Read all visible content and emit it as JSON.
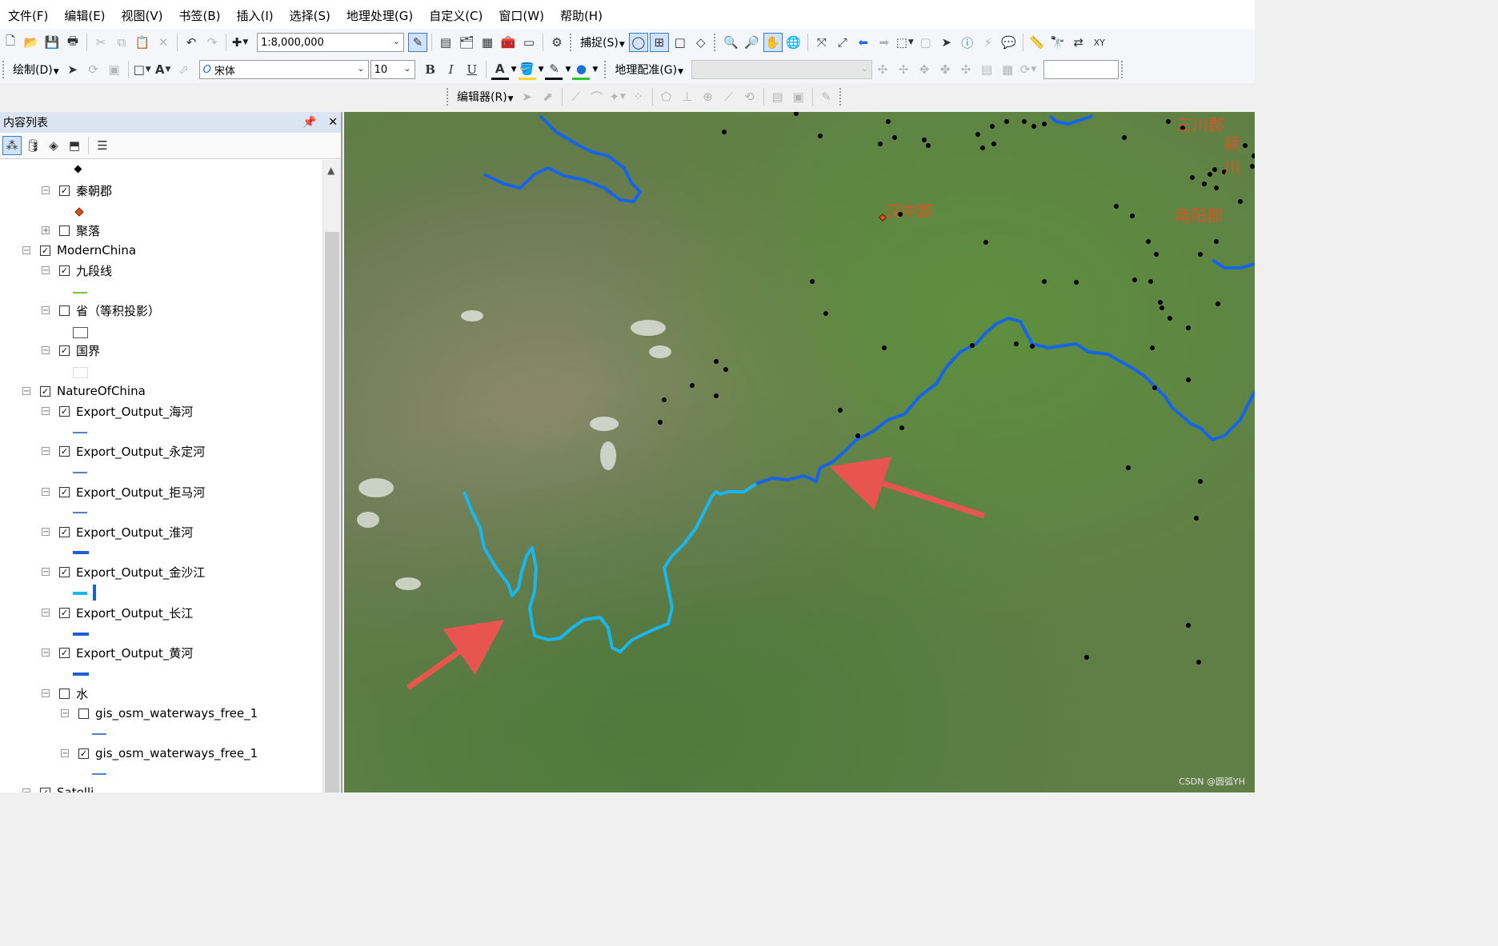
{
  "menu": [
    "文件(F)",
    "编辑(E)",
    "视图(V)",
    "书签(B)",
    "插入(I)",
    "选择(S)",
    "地理处理(G)",
    "自定义(C)",
    "窗口(W)",
    "帮助(H)"
  ],
  "toolbar1": {
    "scale_value": "1:8,000,000",
    "snapping_label": "捕捉(S)"
  },
  "toolbar2": {
    "draw_label": "绘制(D)",
    "font_name": "宋体",
    "font_size": "10",
    "bold": "B",
    "italic": "I",
    "underline": "U",
    "font_color_glyph": "A",
    "georef_label": "地理配准(G)",
    "georef_layer": "",
    "georef_input": ""
  },
  "toolbar3": {
    "editor_label": "编辑器(R)"
  },
  "toc": {
    "title": "内容列表",
    "pin": "ᵖ",
    "close": "✕",
    "rows": [
      {
        "label": "秦朝郡",
        "checked": true
      },
      {
        "label": "聚落",
        "checked": false
      },
      {
        "label": "ModernChina",
        "checked": true
      },
      {
        "label": "九段线",
        "checked": true
      },
      {
        "label": "省（等积投影）",
        "checked": false
      },
      {
        "label": "国界",
        "checked": true
      },
      {
        "label": "NatureOfChina",
        "checked": true
      },
      {
        "label": "Export_Output_海河",
        "checked": true
      },
      {
        "label": "Export_Output_永定河",
        "checked": true
      },
      {
        "label": "Export_Output_拒马河",
        "checked": true
      },
      {
        "label": "Export_Output_淮河",
        "checked": true
      },
      {
        "label": "Export_Output_金沙江",
        "checked": true
      },
      {
        "label": "Export_Output_长江",
        "checked": true
      },
      {
        "label": "Export_Output_黄河",
        "checked": true
      },
      {
        "label": "水",
        "checked": false
      },
      {
        "label": "gis_osm_waterways_free_1",
        "checked": false
      },
      {
        "label": "gis_osm_waterways_free_1",
        "checked": true
      },
      {
        "label": "Satelli",
        "checked": true
      }
    ]
  },
  "map": {
    "labels": [
      "三川郡",
      "颍川",
      "汉中郡",
      "南阳郡"
    ],
    "watermark": "CSDN @圆弧YH",
    "colors": {
      "river_blue": "#1565e8",
      "river_cyan": "#1ab7ee",
      "arrow": "#e85550",
      "label": "#d5562a"
    }
  }
}
